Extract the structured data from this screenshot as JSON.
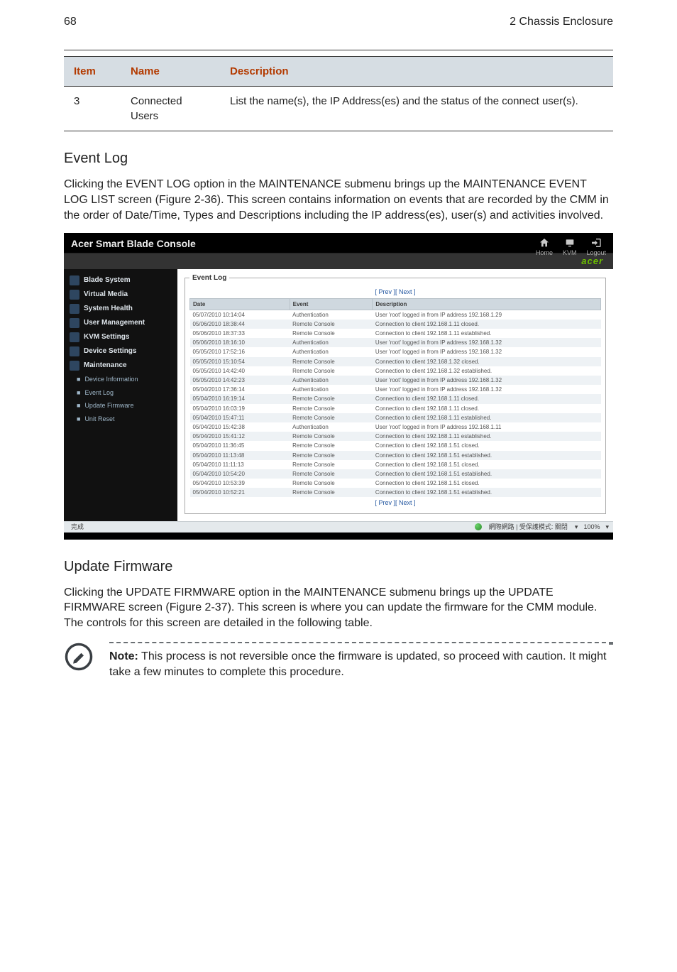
{
  "page": {
    "number": "68",
    "chapter": "2 Chassis Enclosure"
  },
  "table": {
    "headers": {
      "item": "Item",
      "name": "Name",
      "description": "Description"
    },
    "rows": [
      {
        "item": "3",
        "name": "Connected Users",
        "description": "List the name(s), the IP Address(es) and the status of the connect user(s)."
      }
    ]
  },
  "event_log": {
    "heading": "Event Log",
    "para": "Clicking the EVENT LOG option in the MAINTENANCE submenu brings up the MAINTENANCE EVENT LOG LIST screen (Figure 2-36). This screen contains information on events that are recorded by the CMM in the order of Date/Time, Types and Descriptions including the IP address(es), user(s) and activities involved."
  },
  "console": {
    "title": "Acer Smart Blade Console",
    "brand": "acer",
    "top_icons": {
      "home": "Home",
      "kvm": "KVM",
      "logout": "Logout"
    },
    "sidebar": {
      "items": [
        {
          "label": "Blade System"
        },
        {
          "label": "Virtual Media"
        },
        {
          "label": "System Health"
        },
        {
          "label": "User Management"
        },
        {
          "label": "KVM Settings"
        },
        {
          "label": "Device Settings"
        },
        {
          "label": "Maintenance"
        }
      ],
      "sub": [
        {
          "label": "Device Information"
        },
        {
          "label": "Event Log"
        },
        {
          "label": "Update Firmware"
        },
        {
          "label": "Unit Reset"
        }
      ]
    },
    "panel": {
      "legend": "Event Log",
      "pager": "[ Prev ][ Next ]",
      "columns": {
        "date": "Date",
        "event": "Event",
        "description": "Description"
      },
      "rows": [
        {
          "date": "05/07/2010 10:14:04",
          "event": "Authentication",
          "desc": "User 'root' logged in from IP address 192.168.1.29"
        },
        {
          "date": "05/06/2010 18:38:44",
          "event": "Remote Console",
          "desc": "Connection to client 192.168.1.11 closed."
        },
        {
          "date": "05/06/2010 18:37:33",
          "event": "Remote Console",
          "desc": "Connection to client 192.168.1.11 established."
        },
        {
          "date": "05/06/2010 18:16:10",
          "event": "Authentication",
          "desc": "User 'root' logged in from IP address 192.168.1.32"
        },
        {
          "date": "05/05/2010 17:52:16",
          "event": "Authentication",
          "desc": "User 'root' logged in from IP address 192.168.1.32"
        },
        {
          "date": "05/05/2010 15:10:54",
          "event": "Remote Console",
          "desc": "Connection to client 192.168.1.32 closed."
        },
        {
          "date": "05/05/2010 14:42:40",
          "event": "Remote Console",
          "desc": "Connection to client 192.168.1.32 established."
        },
        {
          "date": "05/05/2010 14:42:23",
          "event": "Authentication",
          "desc": "User 'root' logged in from IP address 192.168.1.32"
        },
        {
          "date": "05/04/2010 17:36:14",
          "event": "Authentication",
          "desc": "User 'root' logged in from IP address 192.168.1.32"
        },
        {
          "date": "05/04/2010 16:19:14",
          "event": "Remote Console",
          "desc": "Connection to client 192.168.1.11 closed."
        },
        {
          "date": "05/04/2010 16:03:19",
          "event": "Remote Console",
          "desc": "Connection to client 192.168.1.11 closed."
        },
        {
          "date": "05/04/2010 15:47:11",
          "event": "Remote Console",
          "desc": "Connection to client 192.168.1.11 established."
        },
        {
          "date": "05/04/2010 15:42:38",
          "event": "Authentication",
          "desc": "User 'root' logged in from IP address 192.168.1.11"
        },
        {
          "date": "05/04/2010 15:41:12",
          "event": "Remote Console",
          "desc": "Connection to client 192.168.1.11 established."
        },
        {
          "date": "05/04/2010 11:36:45",
          "event": "Remote Console",
          "desc": "Connection to client 192.168.1.51 closed."
        },
        {
          "date": "05/04/2010 11:13:48",
          "event": "Remote Console",
          "desc": "Connection to client 192.168.1.51 established."
        },
        {
          "date": "05/04/2010 11:11:13",
          "event": "Remote Console",
          "desc": "Connection to client 192.168.1.51 closed."
        },
        {
          "date": "05/04/2010 10:54:20",
          "event": "Remote Console",
          "desc": "Connection to client 192.168.1.51 established."
        },
        {
          "date": "05/04/2010 10:53:39",
          "event": "Remote Console",
          "desc": "Connection to client 192.168.1.51 closed."
        },
        {
          "date": "05/04/2010 10:52:21",
          "event": "Remote Console",
          "desc": "Connection to client 192.168.1.51 established."
        }
      ]
    },
    "statusbar": {
      "left_label": "完成",
      "net_label": "網際網路 | 受保護模式: 關閉",
      "zoom_sep": "▾",
      "zoom": "100%"
    }
  },
  "update_fw": {
    "heading": "Update Firmware",
    "para": "Clicking the UPDATE FIRMWARE option in the MAINTENANCE submenu brings up the UPDATE FIRMWARE screen (Figure 2-37). This screen is where you can update the firmware for the CMM module. The controls for this screen are detailed in the following table."
  },
  "note": {
    "label": "Note:",
    "text": "This process is not reversible once the firmware is updated, so proceed with caution. It might take a few minutes to complete this procedure."
  }
}
